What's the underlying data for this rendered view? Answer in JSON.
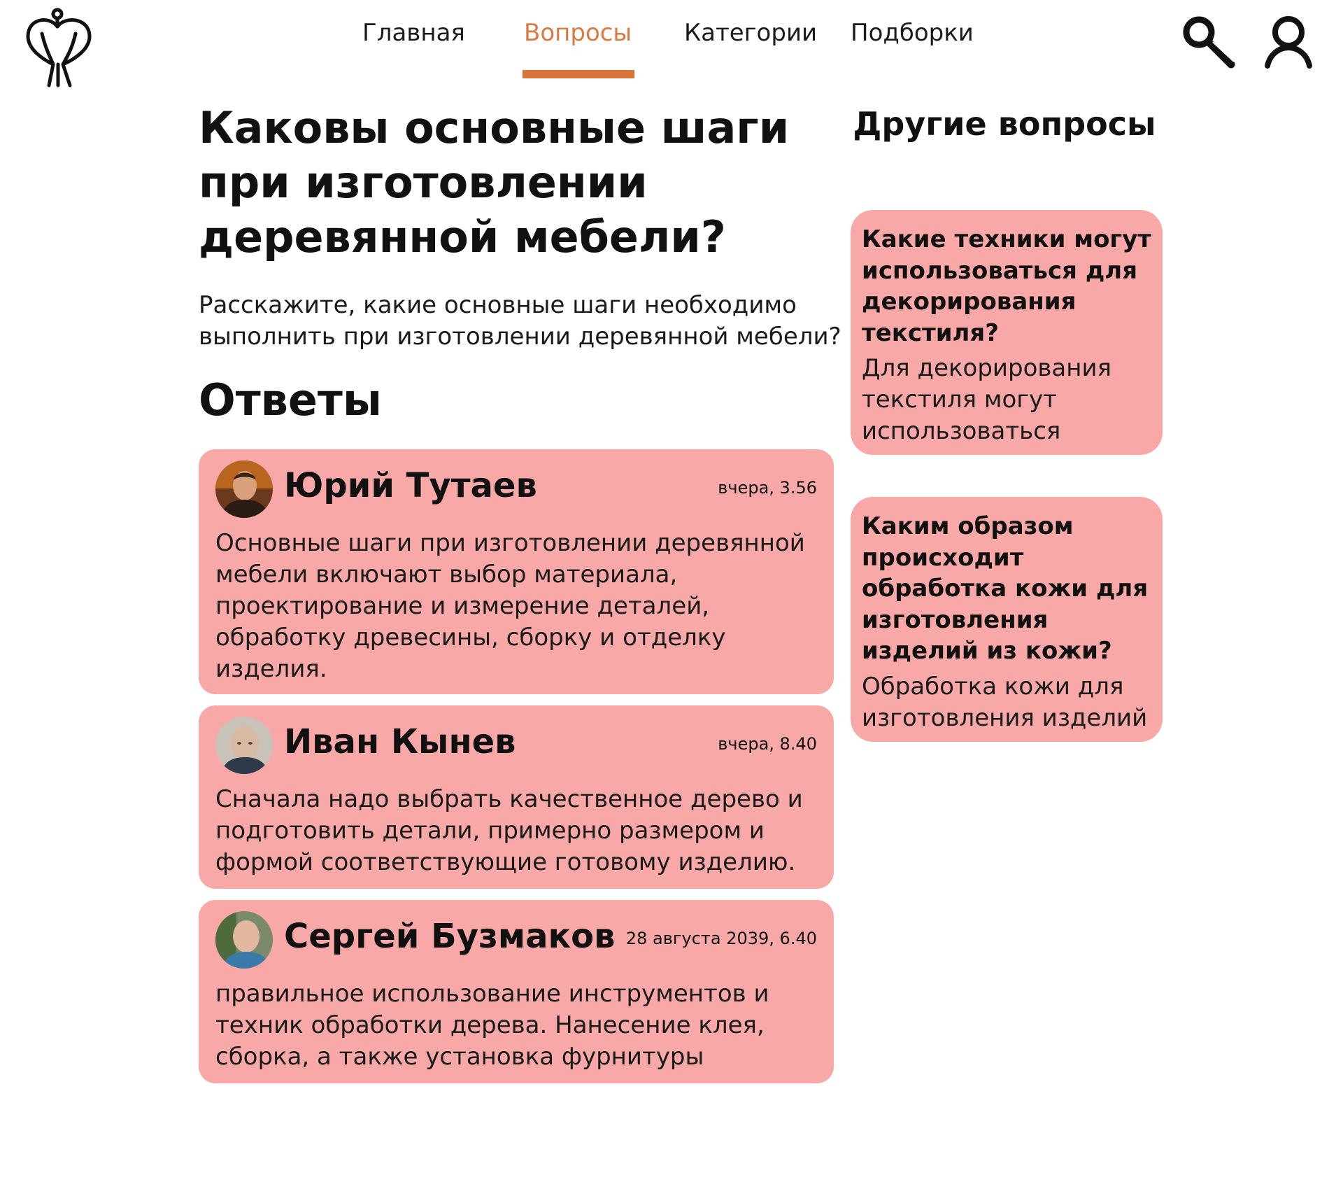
{
  "nav": {
    "items": [
      {
        "label": "Главная"
      },
      {
        "label": "Вопросы",
        "active": true
      },
      {
        "label": "Категории"
      },
      {
        "label": "Подборки"
      }
    ],
    "accent_color": "#d9733a"
  },
  "icons": {
    "logo": "craft-logo-icon",
    "search": "search-icon",
    "profile": "user-icon"
  },
  "question": {
    "title": "Каковы основные шаги при изготовлении деревянной мебели?",
    "description": "Расскажите, какие основные шаги необходимо выполнить при изготовлении деревянной мебели?"
  },
  "answers_heading": "Ответы",
  "answers": [
    {
      "author": "Юрий Тутаев",
      "time": "вчера, 3.56",
      "text": "Основные шаги при изготовлении деревянной мебели включают выбор материала, проектирование и измерение деталей, обработку древесины, сборку и отделку изделия."
    },
    {
      "author": "Иван Кынев",
      "time": "вчера, 8.40",
      "text": "Сначала надо выбрать качественное дерево и подготовить детали, примерно размером и формой соответствующие готовому изделию."
    },
    {
      "author": "Сергей Бузмаков",
      "time": "28 августа 2039, 6.40",
      "text": "правильное использование инструментов и техник обработки дерева. Нанесение клея, сборка, а также установка фурнитуры"
    }
  ],
  "sidebar": {
    "heading": "Другие вопросы",
    "cards": [
      {
        "title": "Какие техники могут использоваться для декорирования текстиля?",
        "excerpt": "Для декорирования текстиля могут использоваться"
      },
      {
        "title": "Каким образом происходит обработка кожи для изготовления изделий из кожи?",
        "excerpt": "Обработка кожи для изготовления изделий"
      }
    ]
  },
  "card_color": "#f9a8a8"
}
